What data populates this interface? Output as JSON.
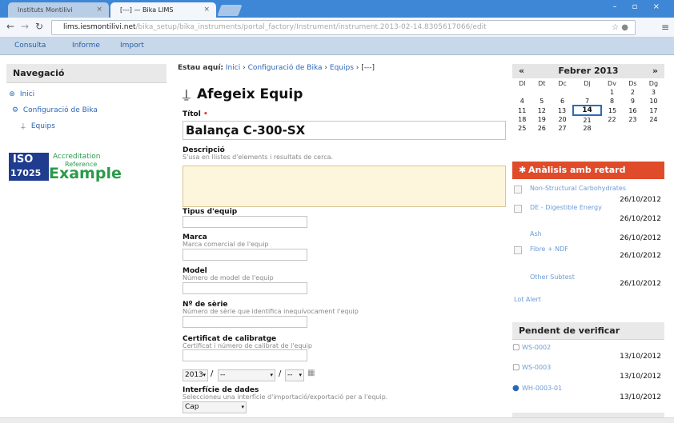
{
  "browser": {
    "tabs": [
      {
        "label": "Instituts Montilivi",
        "close": "×"
      },
      {
        "label": "[---] — Bika LIMS",
        "close": "×"
      }
    ],
    "url_host": "lims.iesmontilivi.net",
    "url_rest": "/bika_setup/bika_instruments/portal_factory/Instrument/instrument.2013-02-14.8305617066/edit",
    "window_controls": "– ▫ ×"
  },
  "appnav": [
    "Consulta",
    "Informe",
    "Import"
  ],
  "sidebar": {
    "title": "Navegació",
    "items": [
      {
        "icon": "home-icon",
        "glyph": "⊛",
        "label": "Inici"
      },
      {
        "icon": "config-icon",
        "glyph": "⚙",
        "label": "Configuració de Bika"
      },
      {
        "icon": "instrument-icon",
        "glyph": "⍊",
        "label": "Equips"
      }
    ],
    "logo": {
      "iso": "ISO",
      "num": "17025",
      "line1": "Accreditation",
      "line2": "Reference",
      "big": "Example"
    }
  },
  "main": {
    "breadcrumb": {
      "prefix": "Estau aquí:",
      "items": [
        "Inici",
        "Configuració de Bika",
        "Equips",
        "[---]"
      ],
      "sep": "›"
    },
    "title": "Afegeix Equip",
    "fields": {
      "title_label": "Títol",
      "title_value": "Balança C-300-SX",
      "desc_label": "Descripció",
      "desc_hint": "S'usa en llistes d'elements i resultats de cerca.",
      "type_label": "Tipus d'equip",
      "brand_label": "Marca",
      "brand_hint": "Marca comercial de l'equip",
      "model_label": "Model",
      "model_hint": "Número de model de l'equip",
      "serial_label": "Nº de sèrie",
      "serial_hint": "Número de sèrie que identifica inequívocament l'equip",
      "calib_label": "Certificat de calibratge",
      "calib_hint": "Certificat i número de calibrat de l'equip",
      "date_year": "2013",
      "date_month": "--",
      "date_day": "--",
      "date_sep": "/",
      "iface_label": "Interfície de dades",
      "iface_hint": "Seleccioneu una interfície d'importació/exportació per a l'equip.",
      "iface_value": "Cap"
    }
  },
  "calendar": {
    "prev": "«",
    "next": "»",
    "title": "Febrer 2013",
    "weekdays": [
      "Dl",
      "Dt",
      "Dc",
      "Dj",
      "Dv",
      "Ds",
      "Dg"
    ],
    "weeks": [
      [
        "",
        "",
        "",
        "",
        "1",
        "2",
        "3"
      ],
      [
        "4",
        "5",
        "6",
        "7",
        "8",
        "9",
        "10"
      ],
      [
        "11",
        "12",
        "13",
        "14",
        "15",
        "16",
        "17"
      ],
      [
        "18",
        "19",
        "20",
        "21",
        "22",
        "23",
        "24"
      ],
      [
        "25",
        "26",
        "27",
        "28",
        "",
        "",
        ""
      ]
    ],
    "today": "14"
  },
  "late": {
    "title": "Anàlisis amb retard",
    "items": [
      {
        "name": "Non-Structural Carbohydrates",
        "date": "26/10/2012"
      },
      {
        "name": "DE - Digestible Energy",
        "date": "26/10/2012"
      },
      {
        "name": "Ash",
        "date": "26/10/2012"
      },
      {
        "name": "Fibre + NDF",
        "date": "26/10/2012"
      },
      {
        "name": "Other Subtest",
        "date": "26/10/2012"
      }
    ],
    "filter": "Lot Alert"
  },
  "verify": {
    "title": "Pendent de verificar",
    "items": [
      {
        "name": "WS-0002",
        "date": "13/10/2012"
      },
      {
        "name": "WS-0003",
        "date": "13/10/2012"
      },
      {
        "name": "WH-0003-01",
        "date": "13/10/2012"
      }
    ]
  },
  "colors": {
    "accent": "#2c67b5",
    "alert": "#e04b2a",
    "chrome": "#3d87d6"
  }
}
